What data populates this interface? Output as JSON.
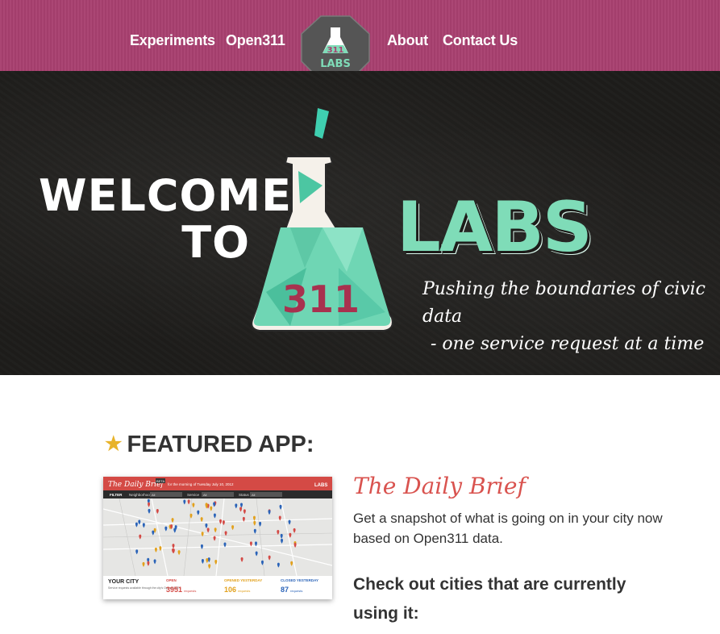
{
  "nav": {
    "left": [
      "Experiments",
      "Open311"
    ],
    "right": [
      "About",
      "Contact Us"
    ],
    "logo_text": "311",
    "logo_sub": "LABS"
  },
  "hero": {
    "welcome": "WELCOME TO",
    "labs": "LABS",
    "flask_label": "311",
    "tagline_line1": "Pushing the boundaries of civic data",
    "tagline_line2": "- one service request at a time"
  },
  "featured": {
    "heading": "FEATURED APP:",
    "app_title": "The Daily Brief",
    "app_desc": "Get a snapshot of what is going on in your city now based on Open311 data.",
    "cta": "Check out cities that are currently using it:"
  },
  "thumb": {
    "title": "The Daily Brief",
    "beta": "BETA",
    "subtitle": "for the morning of Tuesday July 10, 2012",
    "labs": "LABS",
    "filter": "FILTER",
    "neighborhood": "Neighborhood",
    "service": "Service",
    "status": "Status",
    "all": "All",
    "your_city": "YOUR CITY",
    "your_city_desc": "Service requests available through the city's Open311 API.",
    "open_label": "OPEN",
    "open_val": "3951",
    "opened_label": "OPENED YESTERDAY",
    "opened_val": "106",
    "closed_label": "CLOSED YESTERDAY",
    "closed_val": "87",
    "requests": "requests"
  },
  "colors": {
    "nav_bg": "#a8406f",
    "mint": "#7fdcb8",
    "accent_red": "#d9534f",
    "star": "#e8b32a"
  }
}
